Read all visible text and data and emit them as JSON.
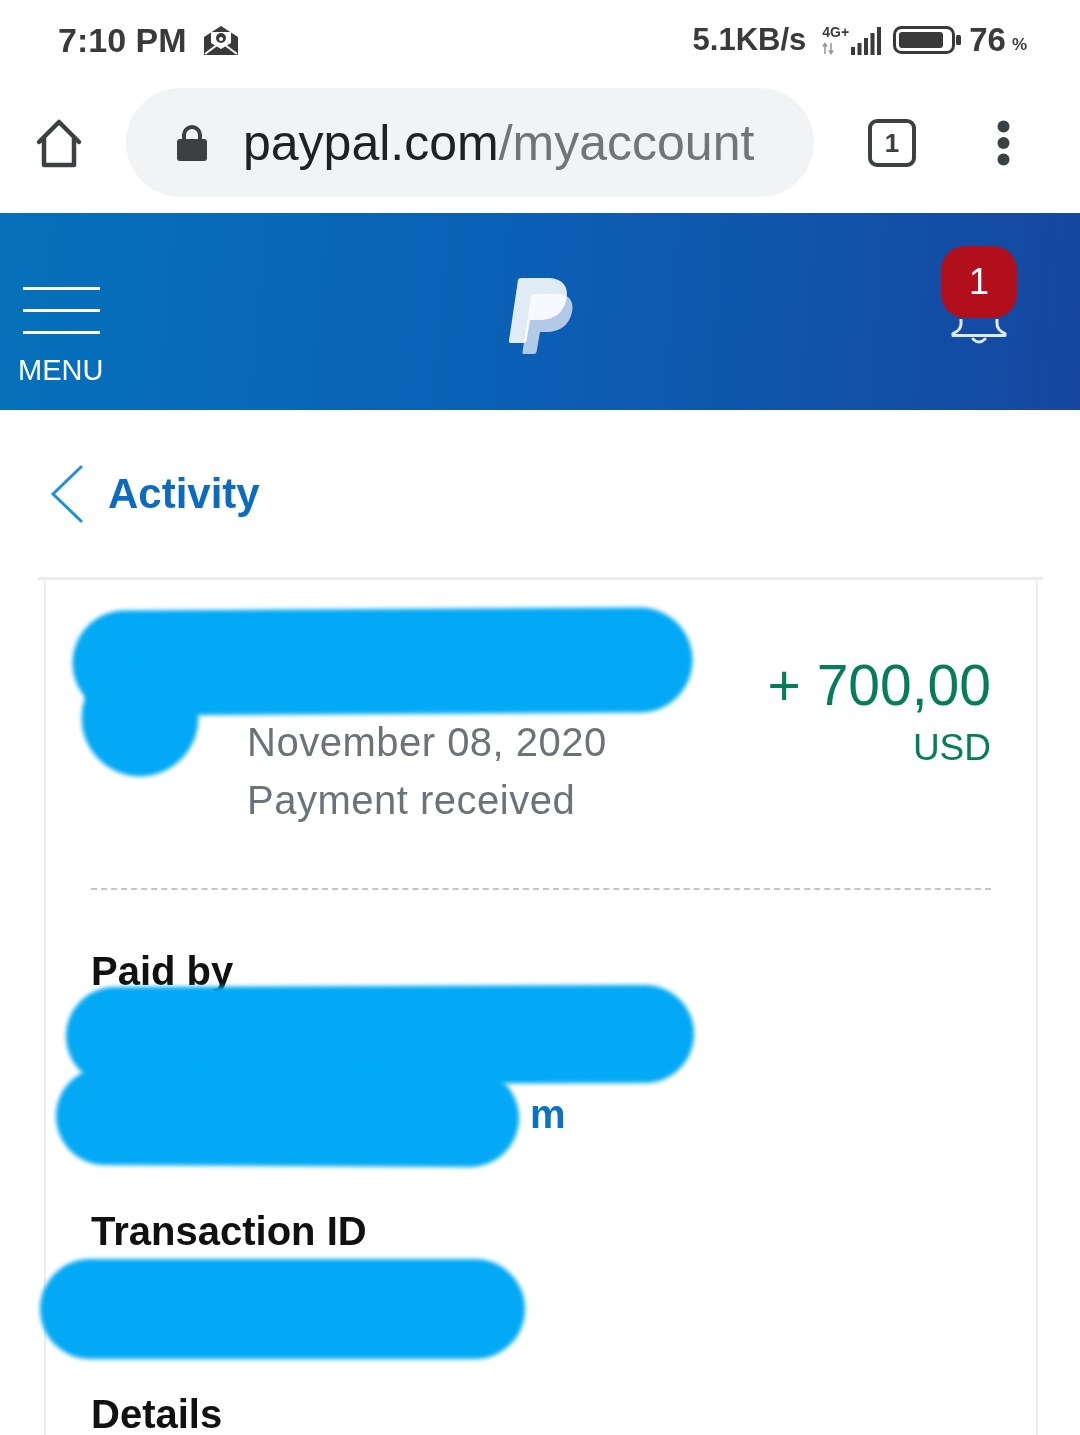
{
  "status_bar": {
    "time": "7:10 PM",
    "net_speed": "5.1KB/s",
    "network_type": "4G+",
    "battery": {
      "value": "76",
      "unit": "%"
    }
  },
  "browser": {
    "url": {
      "domain": "paypal.com",
      "path": "/myaccount"
    },
    "tab_count": "1"
  },
  "header": {
    "menu_label": "MENU",
    "notification_count": "1"
  },
  "page": {
    "back_label": "Activity"
  },
  "transaction": {
    "name_redacted": true,
    "date": "November 08, 2020",
    "status": "Payment received",
    "amount": "+ 700,00",
    "currency": "USD"
  },
  "sections": [
    {
      "heading": "Paid by",
      "value_redacted": true,
      "value": "m"
    },
    {
      "heading": "Transaction ID",
      "value_redacted": true
    },
    {
      "heading": "Details",
      "value_redacted": false
    }
  ]
}
